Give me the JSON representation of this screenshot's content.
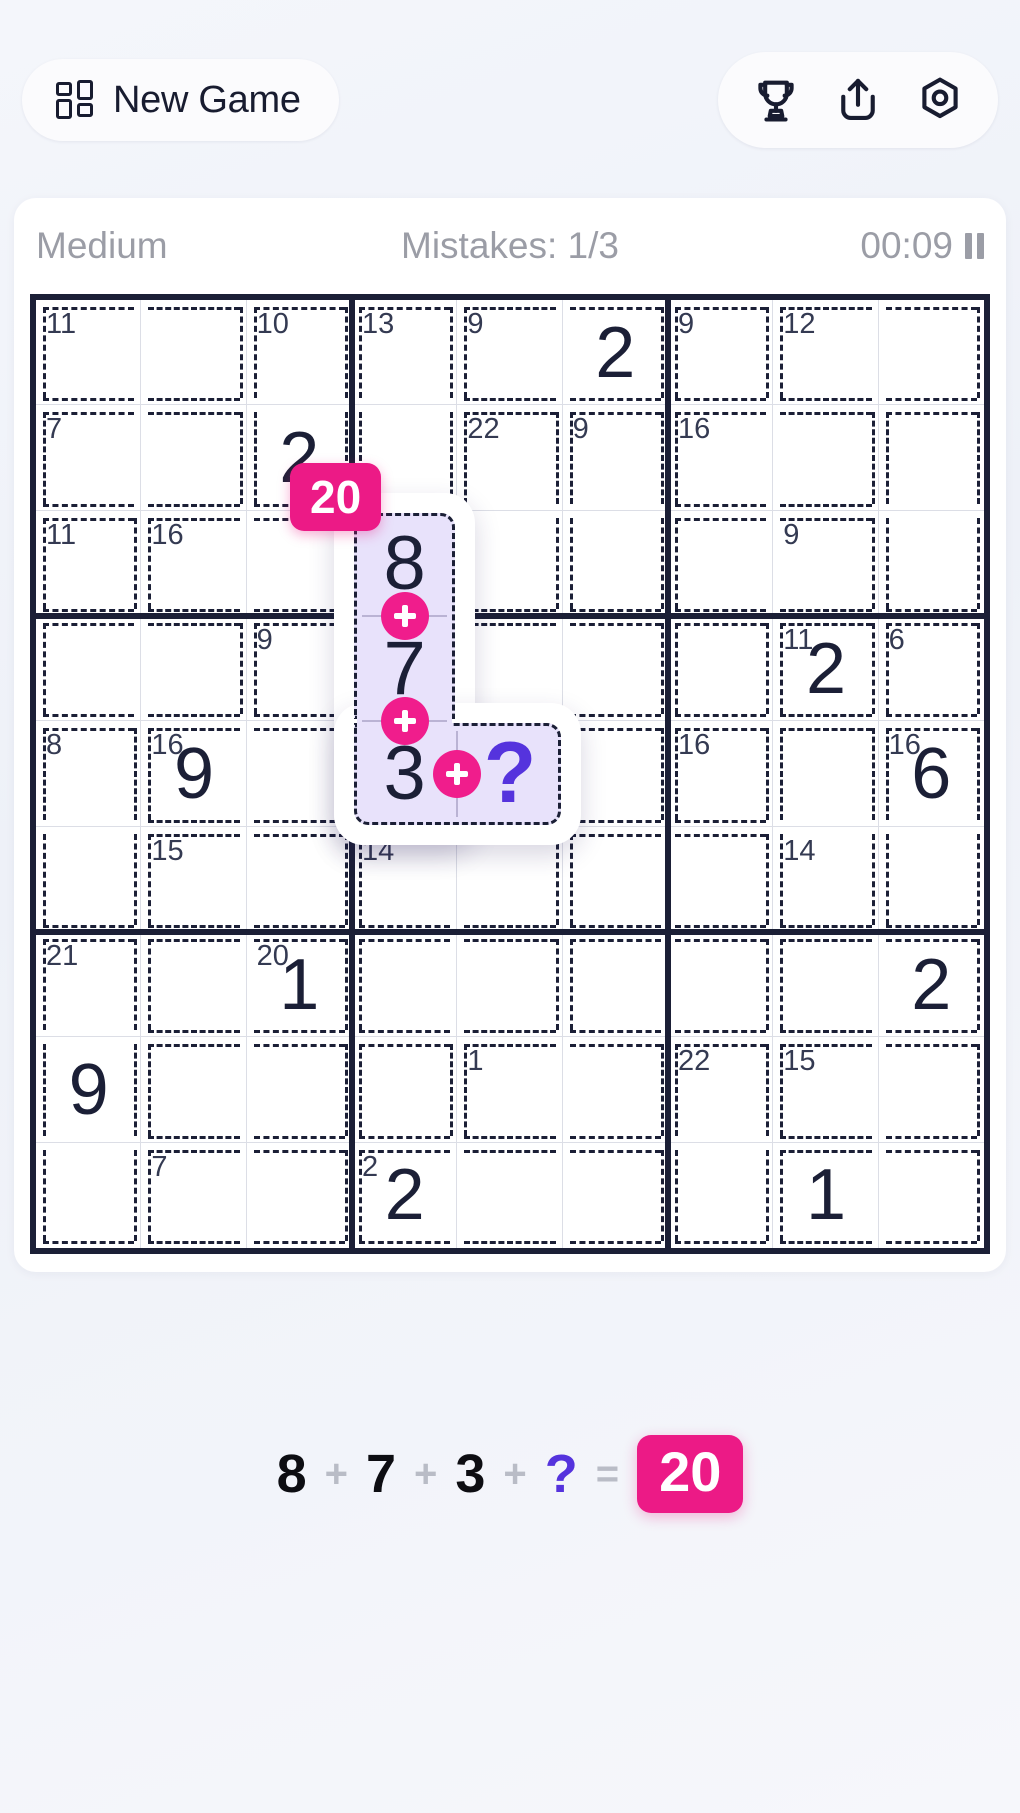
{
  "header": {
    "new_game_label": "New Game",
    "new_game_icon": "grid-icon",
    "actions": [
      {
        "name": "trophy-icon",
        "label": "Leaderboard"
      },
      {
        "name": "share-icon",
        "label": "Share"
      },
      {
        "name": "settings-icon",
        "label": "Settings"
      }
    ]
  },
  "status": {
    "difficulty": "Medium",
    "mistakes": "Mistakes: 1/3",
    "timer": "00:09",
    "pause_icon": "pause-icon"
  },
  "board": {
    "size": 9,
    "cage_sums": [
      {
        "r": 0,
        "c": 0,
        "sum": "11"
      },
      {
        "r": 0,
        "c": 2,
        "sum": "10"
      },
      {
        "r": 0,
        "c": 3,
        "sum": "13"
      },
      {
        "r": 0,
        "c": 4,
        "sum": "9"
      },
      {
        "r": 0,
        "c": 6,
        "sum": "9"
      },
      {
        "r": 0,
        "c": 7,
        "sum": "12"
      },
      {
        "r": 1,
        "c": 0,
        "sum": "7"
      },
      {
        "r": 1,
        "c": 4,
        "sum": "22"
      },
      {
        "r": 1,
        "c": 5,
        "sum": "9"
      },
      {
        "r": 1,
        "c": 6,
        "sum": "16"
      },
      {
        "r": 2,
        "c": 0,
        "sum": "11"
      },
      {
        "r": 2,
        "c": 1,
        "sum": "16"
      },
      {
        "r": 2,
        "c": 7,
        "sum": "9"
      },
      {
        "r": 3,
        "c": 2,
        "sum": "9"
      },
      {
        "r": 3,
        "c": 7,
        "sum": "11"
      },
      {
        "r": 3,
        "c": 8,
        "sum": "6"
      },
      {
        "r": 4,
        "c": 0,
        "sum": "8"
      },
      {
        "r": 4,
        "c": 1,
        "sum": "16"
      },
      {
        "r": 4,
        "c": 6,
        "sum": "16"
      },
      {
        "r": 4,
        "c": 8,
        "sum": "16"
      },
      {
        "r": 5,
        "c": 1,
        "sum": "15"
      },
      {
        "r": 5,
        "c": 3,
        "sum": "14"
      },
      {
        "r": 5,
        "c": 7,
        "sum": "14"
      },
      {
        "r": 6,
        "c": 0,
        "sum": "21"
      },
      {
        "r": 6,
        "c": 2,
        "sum": "20"
      },
      {
        "r": 7,
        "c": 4,
        "sum": "1"
      },
      {
        "r": 7,
        "c": 6,
        "sum": "22"
      },
      {
        "r": 7,
        "c": 7,
        "sum": "15"
      },
      {
        "r": 8,
        "c": 1,
        "sum": "7"
      },
      {
        "r": 8,
        "c": 3,
        "sum": "2"
      }
    ],
    "values": [
      {
        "r": 0,
        "c": 5,
        "v": "2"
      },
      {
        "r": 1,
        "c": 2,
        "v": "2"
      },
      {
        "r": 3,
        "c": 7,
        "v": "2"
      },
      {
        "r": 4,
        "c": 1,
        "v": "9"
      },
      {
        "r": 4,
        "c": 8,
        "v": "6"
      },
      {
        "r": 6,
        "c": 2,
        "v": "1"
      },
      {
        "r": 6,
        "c": 8,
        "v": "2"
      },
      {
        "r": 7,
        "c": 0,
        "v": "9"
      },
      {
        "r": 8,
        "c": 3,
        "v": "2"
      },
      {
        "r": 8,
        "c": 7,
        "v": "1"
      }
    ]
  },
  "highlight": {
    "cage_sum": "20",
    "cells": [
      {
        "value": "8",
        "filled": true
      },
      {
        "value": "7",
        "filled": true
      },
      {
        "value": "3",
        "filled": true
      },
      {
        "value": "?",
        "filled": false
      }
    ],
    "operator": "+",
    "accent_color": "#ec1a86",
    "unknown_color": "#5533dd",
    "fill_color": "#e8e2fb"
  },
  "equation": {
    "terms": [
      "8",
      "7",
      "3"
    ],
    "unknown": "?",
    "operator": "+",
    "equals": "=",
    "result": "20"
  }
}
